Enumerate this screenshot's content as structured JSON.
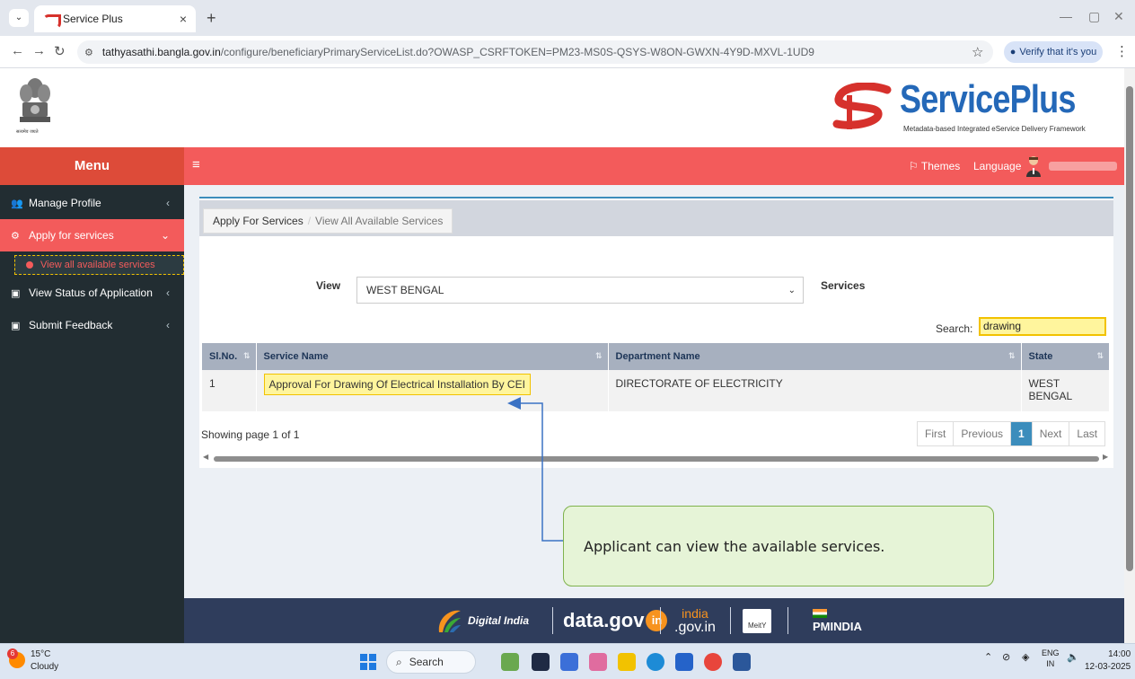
{
  "browser": {
    "tab_title": "Service Plus",
    "tab_close": "×",
    "new_tab": "+",
    "url_host": "tathyasathi.bangla.gov.in",
    "url_path": "/configure/beneficiaryPrimaryServiceList.do?OWASP_CSRFTOKEN=PM23-MS0S-QSYS-W8ON-GWXN-4Y9D-MXVL-1UD9",
    "verify_label": "Verify that it's you",
    "icons": [
      "tab-dropdown-icon",
      "back-arrow-icon",
      "forward-arrow-icon",
      "reload-icon",
      "site-settings-icon",
      "star-icon",
      "kebab-menu-icon",
      "minimize-icon",
      "maximize-icon",
      "close-icon"
    ]
  },
  "header": {
    "emblem_motto": "सत्यमेव जयते",
    "logo_name": "ServicePlus",
    "logo_tagline": "Metadata-based Integrated eService Delivery Framework"
  },
  "navbar": {
    "menu_title": "Menu",
    "themes_label": "Themes",
    "language_label": "Language"
  },
  "sidebar": {
    "items": [
      {
        "label": "Manage Profile",
        "icon": "users-icon"
      },
      {
        "label": "Apply for services",
        "icon": "cogs-icon"
      },
      {
        "label": "View Status of Application",
        "icon": "square-icon"
      },
      {
        "label": "Submit Feedback",
        "icon": "square-icon"
      }
    ],
    "sub_item": "View all available services"
  },
  "main": {
    "breadcrumb": [
      "Apply For Services",
      "View All Available Services"
    ],
    "view_label": "View",
    "view_selected": "WEST BENGAL",
    "services_label": "Services",
    "search_label": "Search:",
    "search_value": "drawing",
    "table": {
      "headers": [
        "Sl.No.",
        "Service Name",
        "Department Name",
        "State"
      ],
      "rows": [
        {
          "slno": "1",
          "service": "Approval For Drawing Of Electrical Installation By CEI",
          "department": "DIRECTORATE OF ELECTRICITY",
          "state": "WEST BENGAL"
        }
      ]
    },
    "showing_text": "Showing page 1 of 1",
    "pager": [
      "First",
      "Previous",
      "1",
      "Next",
      "Last"
    ]
  },
  "callout": "Applicant can view the available services.",
  "footer": {
    "digital_india": "Digital India",
    "data_gov_text": "data.gov",
    "data_gov_badge": "in",
    "india_gov_top": "india",
    "india_gov_bottom": ".gov.in",
    "meity": "MeitY",
    "pmindia": "PMINDIA"
  },
  "taskbar": {
    "temperature": "15°C",
    "weather": "Cloudy",
    "weather_badge": "6",
    "search_label": "Search",
    "lang_top": "ENG",
    "lang_bottom": "IN",
    "time": "14:00",
    "date": "12-03-2025"
  }
}
